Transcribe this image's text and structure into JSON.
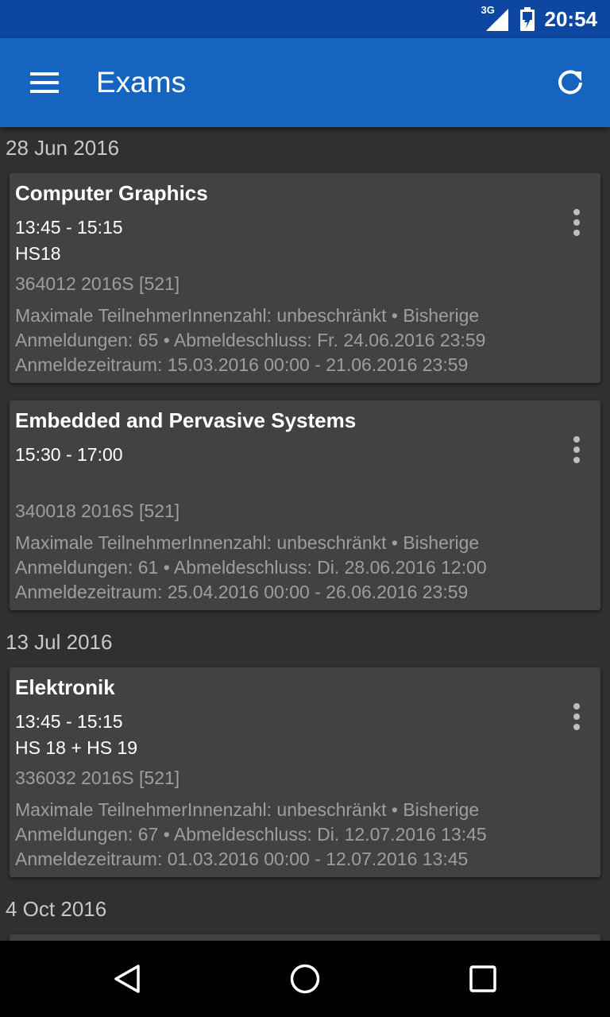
{
  "status_bar": {
    "network": "3G",
    "time": "20:54",
    "icons": [
      "signal-icon",
      "battery-icon"
    ]
  },
  "app_bar": {
    "title": "Exams",
    "menu_icon": "menu-icon",
    "refresh_icon": "refresh-icon"
  },
  "sections": [
    {
      "date": "28 Jun 2016",
      "exams": [
        {
          "title": "Computer Graphics",
          "time": "13:45 - 15:15",
          "room": "HS18",
          "code": "364012 2016S [521]",
          "info": "Maximale TeilnehmerInnenzahl: unbeschränkt • Bisherige Anmeldungen: 65 • Abmeldeschluss: Fr. 24.06.2016 23:59 Anmeldezeitraum: 15.03.2016 00:00 - 21.06.2016 23:59"
        },
        {
          "title": "Embedded and Pervasive Systems",
          "time": "15:30 - 17:00",
          "room": "",
          "code": "340018 2016S [521]",
          "info": "Maximale TeilnehmerInnenzahl: unbeschränkt • Bisherige Anmeldungen: 61 • Abmeldeschluss: Di. 28.06.2016 12:00 Anmeldezeitraum: 25.04.2016 00:00 - 26.06.2016 23:59"
        }
      ]
    },
    {
      "date": "13 Jul 2016",
      "exams": [
        {
          "title": "Elektronik",
          "time": "13:45 - 15:15",
          "room": "HS 18 + HS 19",
          "code": "336032 2016S [521]",
          "info": "Maximale TeilnehmerInnenzahl: unbeschränkt • Bisherige Anmeldungen: 67 • Abmeldeschluss: Di. 12.07.2016 13:45 Anmeldezeitraum: 01.03.2016 00:00 - 12.07.2016 13:45"
        }
      ]
    },
    {
      "date": "4 Oct 2016",
      "exams": []
    }
  ],
  "nav_bar": {
    "icons": [
      "back-icon",
      "home-icon",
      "recents-icon"
    ]
  }
}
